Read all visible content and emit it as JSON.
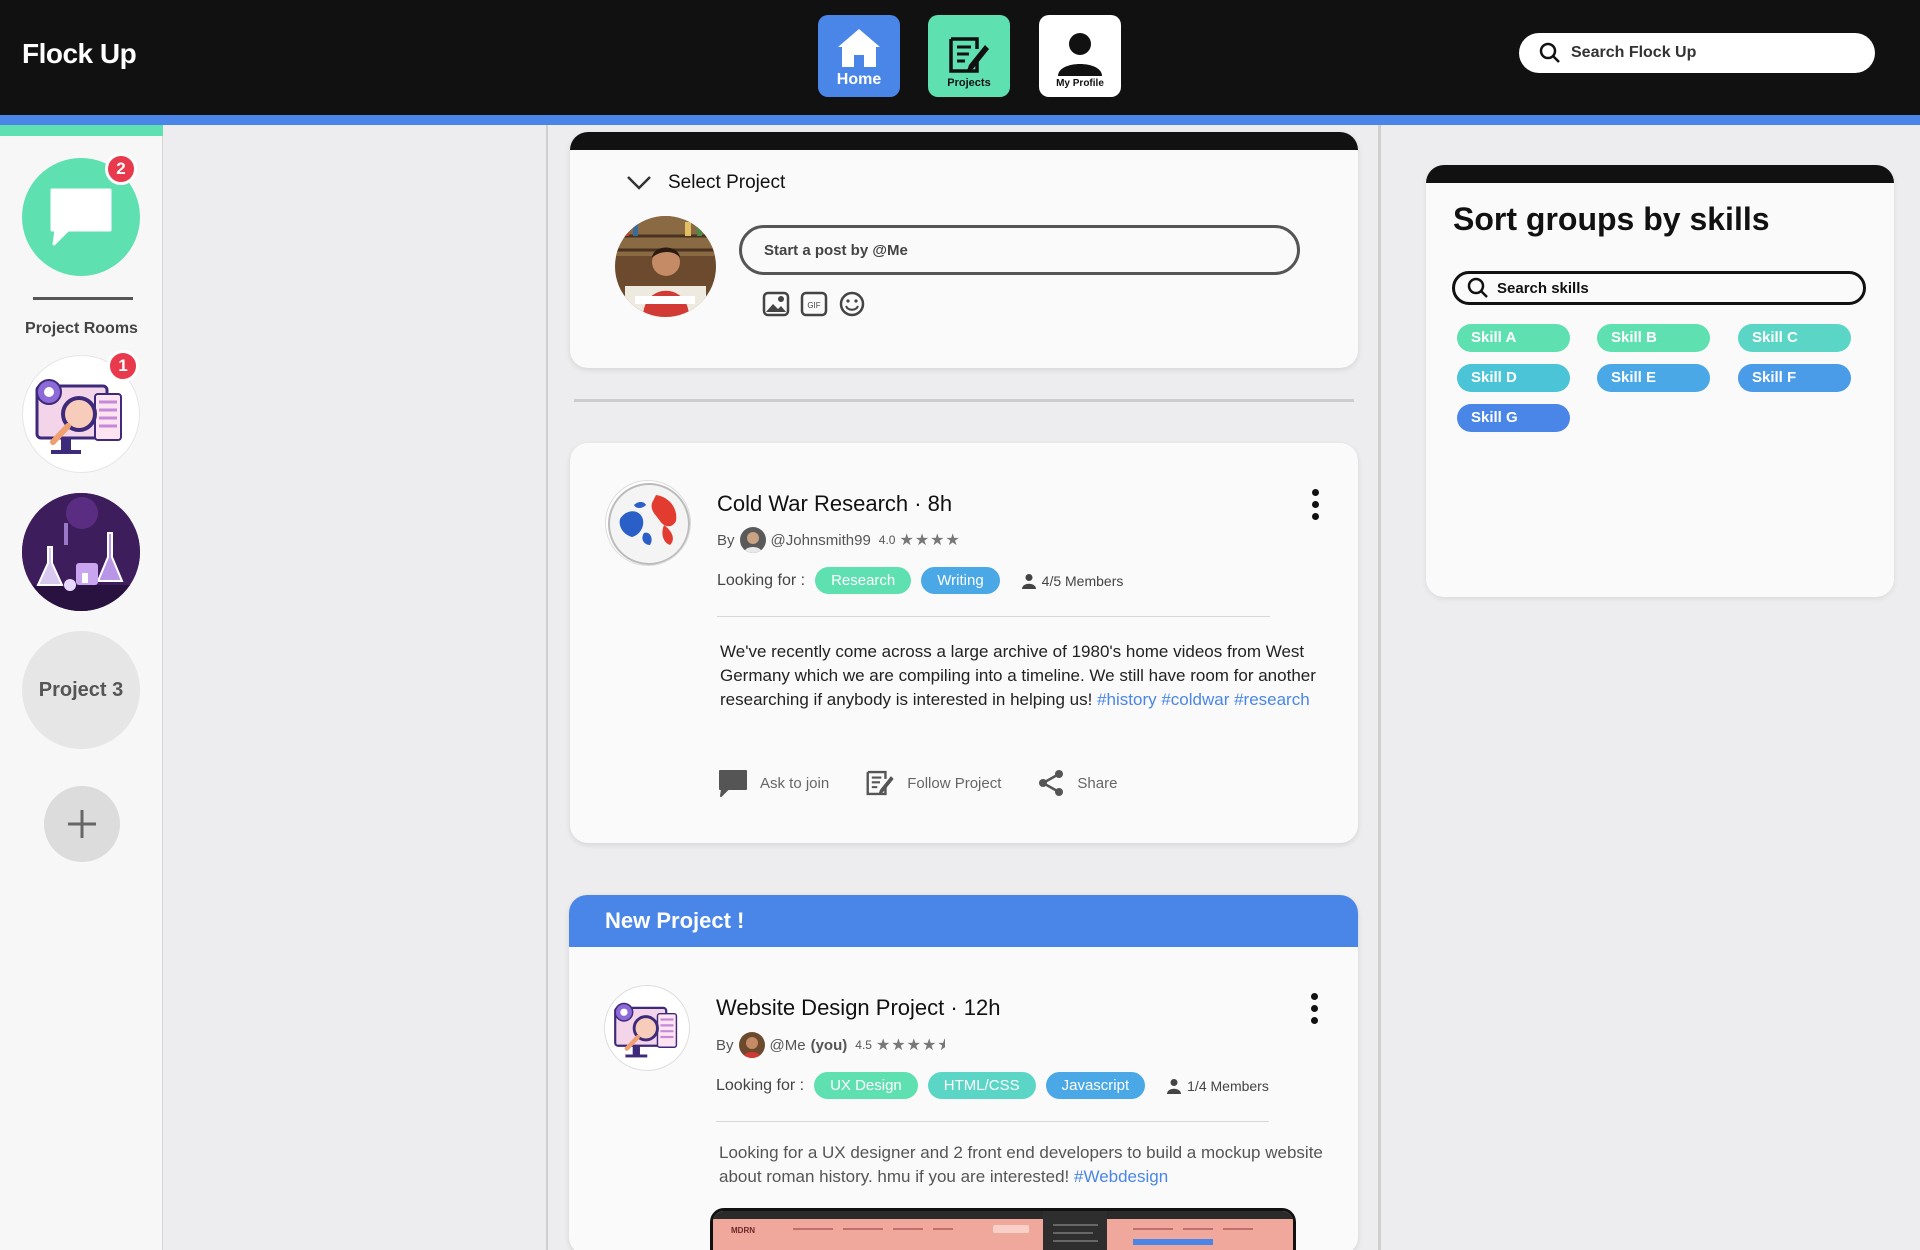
{
  "app": {
    "name": "Flock Up"
  },
  "nav": {
    "home": "Home",
    "projects": "Projects",
    "profile": "My Profile"
  },
  "search": {
    "placeholder": "Search Flock Up"
  },
  "sidebar": {
    "chat_badge": "2",
    "rooms_label": "Project Rooms",
    "room1_badge": "1",
    "room3_label": "Project 3"
  },
  "composer": {
    "select_project": "Select Project",
    "placeholder": "Start a post by @Me",
    "gif_label": "GIF"
  },
  "post1": {
    "title": "Cold War Research · 8h",
    "by": "By",
    "author": "@Johnsmith99",
    "rating": "4.0",
    "stars": "★★★★",
    "looking_for": "Looking for :",
    "tags": [
      "Research",
      "Writing"
    ],
    "members": "4/5 Members",
    "body": "We've recently come across a large archive of 1980's home videos from West Germany which we are compiling into a timeline. We still have room for another researching if anybody is interested in helping us!",
    "hashtags": "#history #coldwar #research",
    "actions": {
      "ask": "Ask to join",
      "follow": "Follow Project",
      "share": "Share"
    }
  },
  "post2": {
    "banner": "New Project !",
    "title": "Website Design Project · 12h",
    "by": "By",
    "author": "@Me",
    "author_suffix": "(you)",
    "rating": "4.5",
    "stars": "★★★★",
    "looking_for": "Looking for :",
    "tags": [
      "UX Design",
      "HTML/CSS",
      "Javascript"
    ],
    "members": "1/4 Members",
    "body": "Looking for a UX designer and 2 front end developers to build a mockup website about roman history. hmu if you are interested!",
    "hashtags": "#Webdesign",
    "preview_brand": "MDRN"
  },
  "skills_panel": {
    "title": "Sort groups by skills",
    "search_placeholder": "Search skills",
    "skills": [
      "Skill A",
      "Skill B",
      "Skill C",
      "Skill D",
      "Skill E",
      "Skill F",
      "Skill G"
    ]
  },
  "colors": {
    "accent_blue": "#4a86e8",
    "accent_green": "#5fe0b0",
    "badge_red": "#e8394d"
  }
}
